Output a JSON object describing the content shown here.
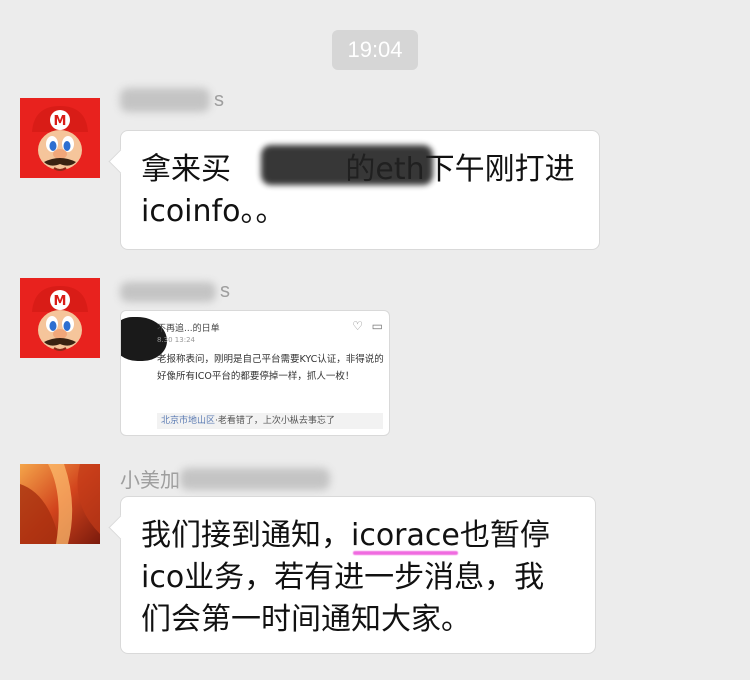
{
  "timestamp": "19:04",
  "messages": [
    {
      "sender_suffix": "s",
      "text": "拿来买            的eth下午刚打进\nicoinfo。。"
    },
    {
      "sender_suffix": "s",
      "screenshot": {
        "poster": "不再追...的日单",
        "date": "8.30 13:24",
        "body": "老报称表问，刚明是自己平台需要KYC认证，非得说的好像所有ICO平台的都要停掉一样，抓人一枚！",
        "reply_name": "北京市地山区",
        "reply_text": "·老看错了，上次小枞去事忘了"
      }
    },
    {
      "sender_name": "小美加",
      "text_before": "我们接到通知，",
      "text_highlight": "icorace",
      "text_after": "也暂停\nico业务，若有进一步消息，我\n们会第一时间通知大家。"
    }
  ],
  "colors": {
    "background": "#ececec",
    "bubble": "#ffffff",
    "highlight": "#f06be0",
    "time_badge": "#d6d6d6"
  }
}
